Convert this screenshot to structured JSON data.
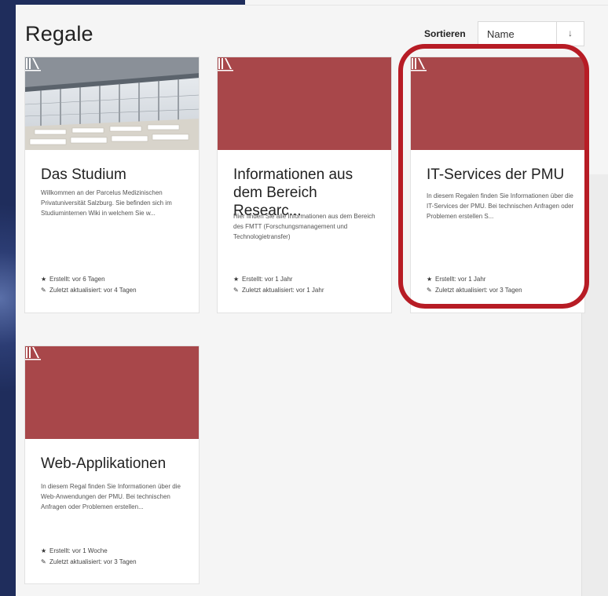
{
  "page": {
    "title": "Regale"
  },
  "sort": {
    "label": "Sortieren",
    "value": "Name",
    "direction_icon": "↓"
  },
  "shelves": [
    {
      "title": "Das Studium",
      "has_photo": true,
      "description": "Willkommen an der Parcelus Medizinischen Privatuniversität Salzburg. Sie befinden sich im Studiuminternen Wiki in welchem Sie w...",
      "created": "Erstellt: vor 6 Tagen",
      "updated": "Zuletzt aktualisiert: vor 4 Tagen"
    },
    {
      "title": "Informationen aus dem Bereich Researc...",
      "has_photo": false,
      "description": "Hier finden Sie alle Informationen aus dem Bereich des FMTT (Forschungsmanagement und Technologietransfer)",
      "created": "Erstellt: vor 1 Jahr",
      "updated": "Zuletzt aktualisiert: vor 1 Jahr"
    },
    {
      "title": "IT-Services der PMU",
      "has_photo": false,
      "highlighted": true,
      "description": "In diesem Regalen finden Sie Informationen über die IT-Services der PMU. Bei technischen Anfragen oder Problemen erstellen S...",
      "created": "Erstellt: vor 1 Jahr",
      "updated": "Zuletzt aktualisiert: vor 3 Tagen"
    },
    {
      "title": "Web-Applikationen",
      "has_photo": false,
      "description": "In diesem Regal finden Sie Informationen über die Web-Anwendungen der PMU. Bei technischen Anfragen oder Problemen erstellen...",
      "created": "Erstellt: vor 1 Woche",
      "updated": "Zuletzt aktualisiert: vor 3 Tagen"
    }
  ],
  "icons": {
    "created": "star-icon",
    "updated": "pencil-icon",
    "shelf": "bookshelf-logo-icon",
    "sort": "arrow-down-icon"
  },
  "colors": {
    "card_header": "#a8474a",
    "highlight": "#b71c25",
    "background": "#1f2d5c"
  }
}
